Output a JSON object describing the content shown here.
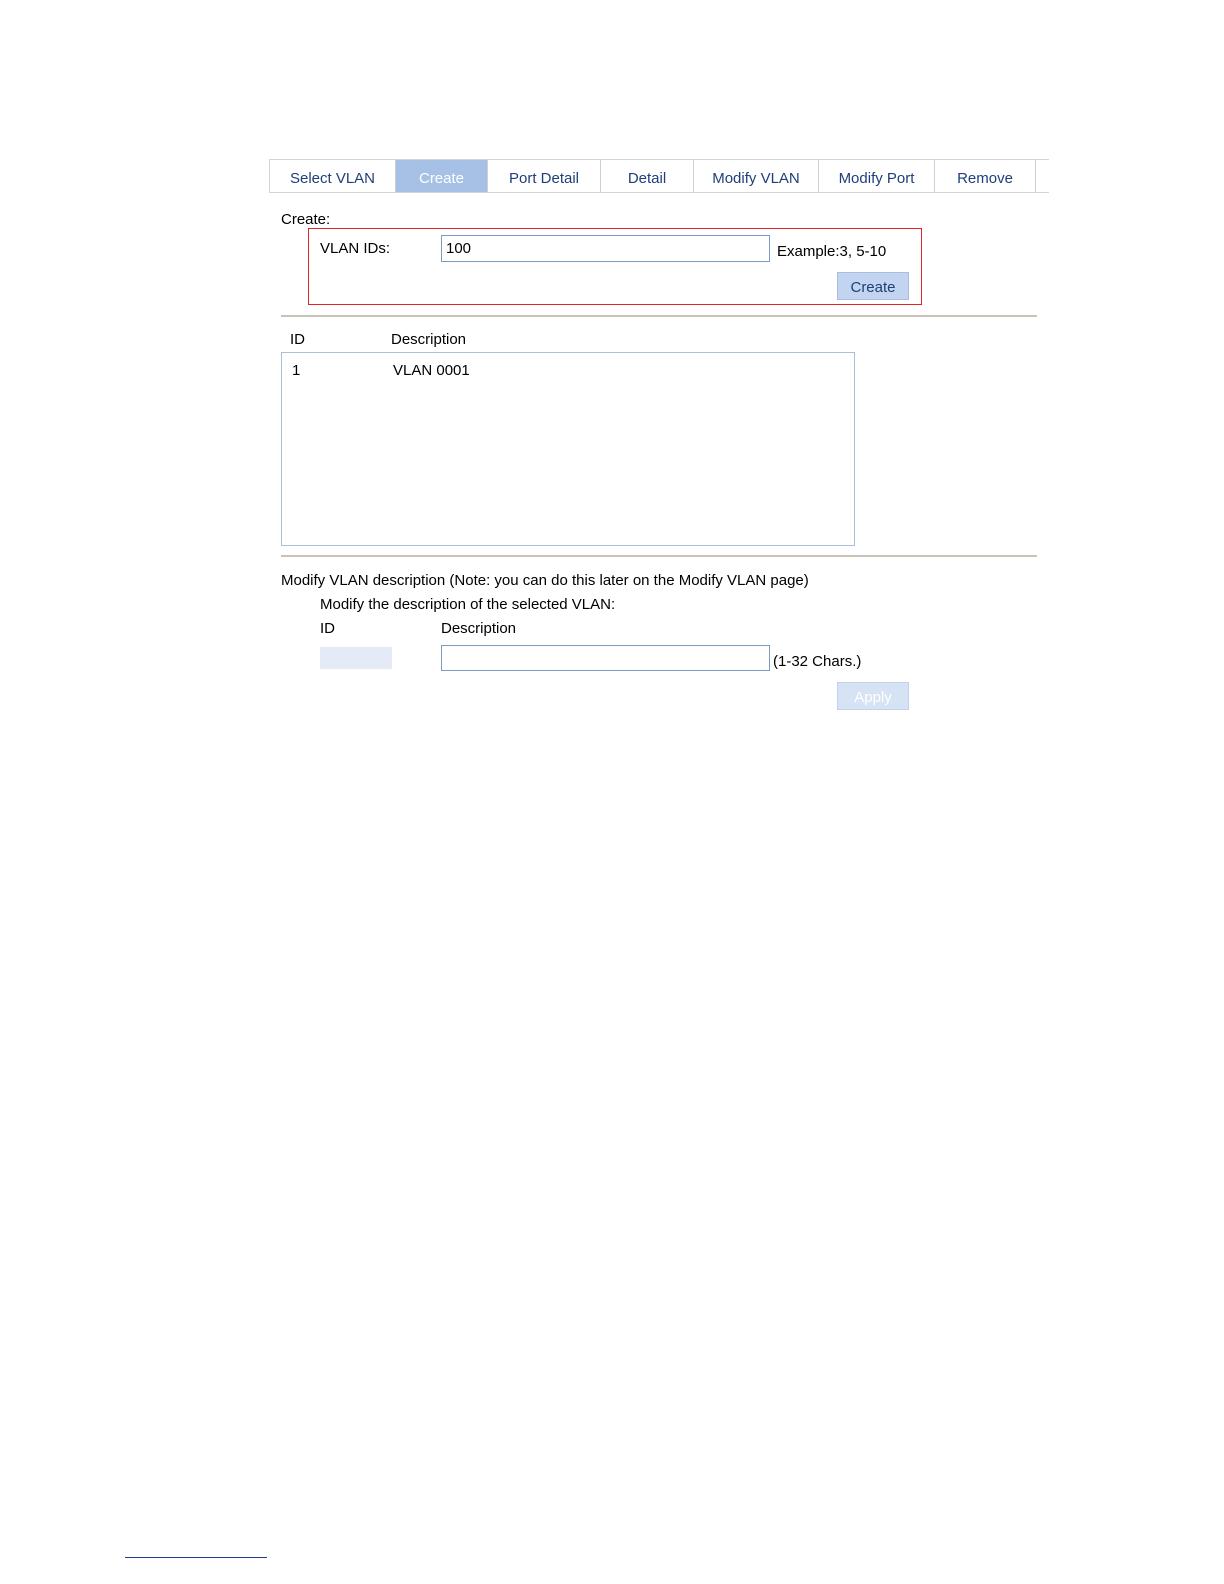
{
  "tabs": [
    {
      "label": "Select VLAN",
      "active": false
    },
    {
      "label": "Create",
      "active": true
    },
    {
      "label": "Port Detail",
      "active": false
    },
    {
      "label": "Detail",
      "active": false
    },
    {
      "label": "Modify VLAN",
      "active": false
    },
    {
      "label": "Modify Port",
      "active": false
    },
    {
      "label": "Remove",
      "active": false
    }
  ],
  "create": {
    "section_label": "Create:",
    "vlan_ids_label": "VLAN IDs:",
    "vlan_ids_value": "100",
    "example_hint": "Example:3, 5-10",
    "create_button": "Create",
    "highlight_color": "#e0242a"
  },
  "vlan_table": {
    "headers": {
      "id": "ID",
      "description": "Description"
    },
    "rows": [
      {
        "id": "1",
        "description": "VLAN 0001"
      }
    ]
  },
  "modify": {
    "section_title": "Modify VLAN description (Note: you can do this later on the Modify VLAN page)",
    "subtitle": "Modify the description of the selected VLAN:",
    "id_header": "ID",
    "description_header": "Description",
    "description_value": "",
    "chars_hint": "(1-32 Chars.)",
    "apply_button": "Apply"
  },
  "colors": {
    "tab_active_bg": "#a7c1e6",
    "tab_text": "#1e3f7a",
    "button_bg": "#c2d4ef",
    "divider": "#c9c3b5"
  }
}
